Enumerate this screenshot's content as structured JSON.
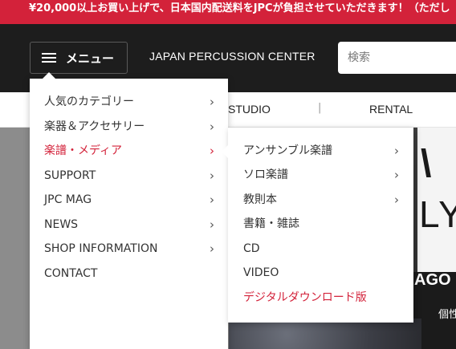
{
  "announcement": "¥20,000以上お買い上げで、日本国内配送料をJPCが負担させていただきます！（ただし",
  "header": {
    "menu_label": "メニュー",
    "brand": "JAPAN PERCUSSION CENTER",
    "search_placeholder": "検索"
  },
  "subnav": {
    "items": [
      "STUDIO",
      "RENTAL"
    ],
    "separator": "|"
  },
  "hero": {
    "big_letters": "LY",
    "chevron_text": "\\",
    "overlay_title": "AGO",
    "overlay_sub": "個性"
  },
  "menu": {
    "items": [
      {
        "label": "人気のカテゴリー",
        "arrow": "›"
      },
      {
        "label": "楽器＆アクセサリー",
        "arrow": "›"
      },
      {
        "label": "楽譜・メディア",
        "arrow": "›",
        "active": true
      },
      {
        "label": "SUPPORT",
        "arrow": "›"
      },
      {
        "label": "JPC MAG",
        "arrow": "›"
      },
      {
        "label": "NEWS",
        "arrow": "›"
      },
      {
        "label": "SHOP INFORMATION",
        "arrow": "›"
      },
      {
        "label": "CONTACT"
      }
    ]
  },
  "submenu": {
    "items": [
      {
        "label": "アンサンブル楽譜",
        "arrow": "›"
      },
      {
        "label": "ソロ楽譜",
        "arrow": "›"
      },
      {
        "label": "教則本",
        "arrow": "›"
      },
      {
        "label": "書籍・雑誌"
      },
      {
        "label": "CD"
      },
      {
        "label": "VIDEO"
      },
      {
        "label": "デジタルダウンロード版",
        "highlight": true
      }
    ]
  },
  "colors": {
    "accent": "#d3223a",
    "header_bg": "#1d1d1d",
    "text": "#333333"
  }
}
